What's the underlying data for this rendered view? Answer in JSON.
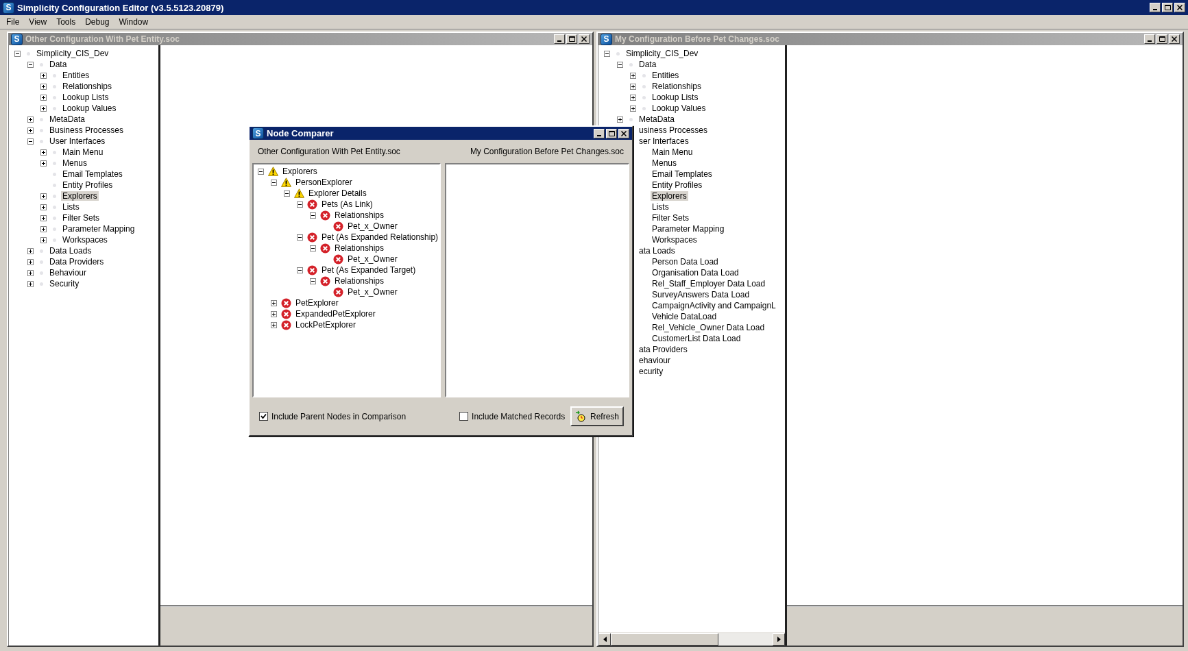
{
  "window": {
    "title": "Simplicity Configuration Editor (v3.5.5123.20879)",
    "icon_letter": "S"
  },
  "menu": [
    "File",
    "View",
    "Tools",
    "Debug",
    "Window"
  ],
  "documents": [
    {
      "title": "Other Configuration With Pet Entity.soc",
      "icon_letter": "S",
      "tree": [
        {
          "label": "Simplicity_CIS_Dev",
          "expanded": true,
          "selected": false,
          "clipped": false,
          "children": [
            {
              "label": "Data",
              "expanded": true,
              "selected": false,
              "clipped": false,
              "children": [
                {
                  "label": "Entities",
                  "expanded": false,
                  "selected": false,
                  "clipped": false
                },
                {
                  "label": "Relationships",
                  "expanded": false,
                  "selected": false,
                  "clipped": false
                },
                {
                  "label": "Lookup Lists",
                  "expanded": false,
                  "selected": false,
                  "clipped": false
                },
                {
                  "label": "Lookup Values",
                  "expanded": false,
                  "selected": false,
                  "clipped": false
                }
              ]
            },
            {
              "label": "MetaData",
              "expanded": false,
              "selected": false,
              "clipped": false
            },
            {
              "label": "Business Processes",
              "expanded": false,
              "selected": false,
              "clipped": false
            },
            {
              "label": "User Interfaces",
              "expanded": true,
              "selected": false,
              "clipped": false,
              "children": [
                {
                  "label": "Main Menu",
                  "expanded": false,
                  "selected": false,
                  "clipped": false
                },
                {
                  "label": "Menus",
                  "expanded": false,
                  "selected": false,
                  "clipped": false
                },
                {
                  "label": "Email Templates",
                  "selected": false,
                  "clipped": false
                },
                {
                  "label": "Entity Profiles",
                  "selected": false,
                  "clipped": false
                },
                {
                  "label": "Explorers",
                  "expanded": false,
                  "selected": true,
                  "clipped": false
                },
                {
                  "label": "Lists",
                  "expanded": false,
                  "selected": false,
                  "clipped": false
                },
                {
                  "label": "Filter Sets",
                  "expanded": false,
                  "selected": false,
                  "clipped": false
                },
                {
                  "label": "Parameter Mapping",
                  "expanded": false,
                  "selected": false,
                  "clipped": false
                },
                {
                  "label": "Workspaces",
                  "expanded": false,
                  "selected": false,
                  "clipped": false
                }
              ]
            },
            {
              "label": "Data Loads",
              "expanded": false,
              "selected": false,
              "clipped": false
            },
            {
              "label": "Data Providers",
              "expanded": false,
              "selected": false,
              "clipped": false
            },
            {
              "label": "Behaviour",
              "expanded": false,
              "selected": false,
              "clipped": false
            },
            {
              "label": "Security",
              "expanded": false,
              "selected": false,
              "clipped": false
            }
          ]
        }
      ]
    },
    {
      "title": "My Configuration Before Pet Changes.soc",
      "icon_letter": "S",
      "tree": [
        {
          "label": "Simplicity_CIS_Dev",
          "expanded": true,
          "selected": false,
          "clipped": false,
          "children": [
            {
              "label": "Data",
              "expanded": true,
              "selected": false,
              "clipped": false,
              "children": [
                {
                  "label": "Entities",
                  "expanded": false,
                  "selected": false,
                  "clipped": false
                },
                {
                  "label": "Relationships",
                  "expanded": false,
                  "selected": false,
                  "clipped": false
                },
                {
                  "label": "Lookup Lists",
                  "expanded": false,
                  "selected": false,
                  "clipped": false
                },
                {
                  "label": "Lookup Values",
                  "expanded": false,
                  "selected": false,
                  "clipped": false
                }
              ]
            },
            {
              "label": "MetaData",
              "expanded": false,
              "selected": false,
              "clipped": false
            },
            {
              "label": "usiness Processes",
              "selected": false,
              "clipped": true
            },
            {
              "label": "ser Interfaces",
              "selected": false,
              "clipped": true,
              "children": [
                {
                  "label": "Main Menu",
                  "selected": false,
                  "clipped": true
                },
                {
                  "label": "Menus",
                  "selected": false,
                  "clipped": true
                },
                {
                  "label": "Email Templates",
                  "selected": false,
                  "clipped": true
                },
                {
                  "label": "Entity Profiles",
                  "selected": false,
                  "clipped": true
                },
                {
                  "label": "Explorers",
                  "selected": true,
                  "clipped": true
                },
                {
                  "label": "Lists",
                  "selected": false,
                  "clipped": true
                },
                {
                  "label": "Filter Sets",
                  "selected": false,
                  "clipped": true
                },
                {
                  "label": "Parameter Mapping",
                  "selected": false,
                  "clipped": true
                },
                {
                  "label": "Workspaces",
                  "selected": false,
                  "clipped": true
                }
              ]
            },
            {
              "label": "ata Loads",
              "selected": false,
              "clipped": true,
              "children": [
                {
                  "label": "Person Data Load",
                  "selected": false,
                  "clipped": true
                },
                {
                  "label": "Organisation Data Load",
                  "selected": false,
                  "clipped": true
                },
                {
                  "label": "Rel_Staff_Employer Data Load",
                  "selected": false,
                  "clipped": true
                },
                {
                  "label": "SurveyAnswers Data Load",
                  "selected": false,
                  "clipped": true
                },
                {
                  "label": "CampaignActivity and CampaignL",
                  "selected": false,
                  "clipped": true
                },
                {
                  "label": "Vehicle DataLoad",
                  "selected": false,
                  "clipped": true
                },
                {
                  "label": "Rel_Vehicle_Owner Data Load",
                  "selected": false,
                  "clipped": true
                },
                {
                  "label": "CustomerList Data Load",
                  "selected": false,
                  "clipped": true
                }
              ]
            },
            {
              "label": "ata Providers",
              "selected": false,
              "clipped": true
            },
            {
              "label": "ehaviour",
              "selected": false,
              "clipped": true
            },
            {
              "label": "ecurity",
              "selected": false,
              "clipped": true
            }
          ]
        }
      ]
    }
  ],
  "dialog": {
    "title": "Node Comparer",
    "icon_letter": "S",
    "left_label": "Other Configuration With Pet Entity.soc",
    "right_label": "My Configuration Before Pet Changes.soc",
    "tree": [
      {
        "label": "Explorers",
        "kind": "warning",
        "expanded": true,
        "children": [
          {
            "label": "PersonExplorer",
            "kind": "warning",
            "expanded": true,
            "children": [
              {
                "label": "Explorer Details",
                "kind": "warning",
                "expanded": true,
                "children": [
                  {
                    "label": "Pets (As Link)",
                    "kind": "error",
                    "expanded": true,
                    "children": [
                      {
                        "label": "Relationships",
                        "kind": "error",
                        "expanded": true,
                        "children": [
                          {
                            "label": "Pet_x_Owner",
                            "kind": "error"
                          }
                        ]
                      }
                    ]
                  },
                  {
                    "label": "Pet (As Expanded Relationship)",
                    "kind": "error",
                    "expanded": true,
                    "children": [
                      {
                        "label": "Relationships",
                        "kind": "error",
                        "expanded": true,
                        "children": [
                          {
                            "label": "Pet_x_Owner",
                            "kind": "error"
                          }
                        ]
                      }
                    ]
                  },
                  {
                    "label": "Pet (As Expanded Target)",
                    "kind": "error",
                    "expanded": true,
                    "children": [
                      {
                        "label": "Relationships",
                        "kind": "error",
                        "expanded": true,
                        "children": [
                          {
                            "label": "Pet_x_Owner",
                            "kind": "error"
                          }
                        ]
                      }
                    ]
                  }
                ]
              }
            ]
          },
          {
            "label": "PetExplorer",
            "kind": "error",
            "expanded": false
          },
          {
            "label": "ExpandedPetExplorer",
            "kind": "error",
            "expanded": false
          },
          {
            "label": "LockPetExplorer",
            "kind": "error",
            "expanded": false
          }
        ]
      }
    ],
    "options": [
      {
        "label": "Include Parent Nodes in Comparison",
        "checked": true
      },
      {
        "label": "Include Matched Records",
        "checked": false
      }
    ],
    "refresh_button": "Refresh"
  }
}
